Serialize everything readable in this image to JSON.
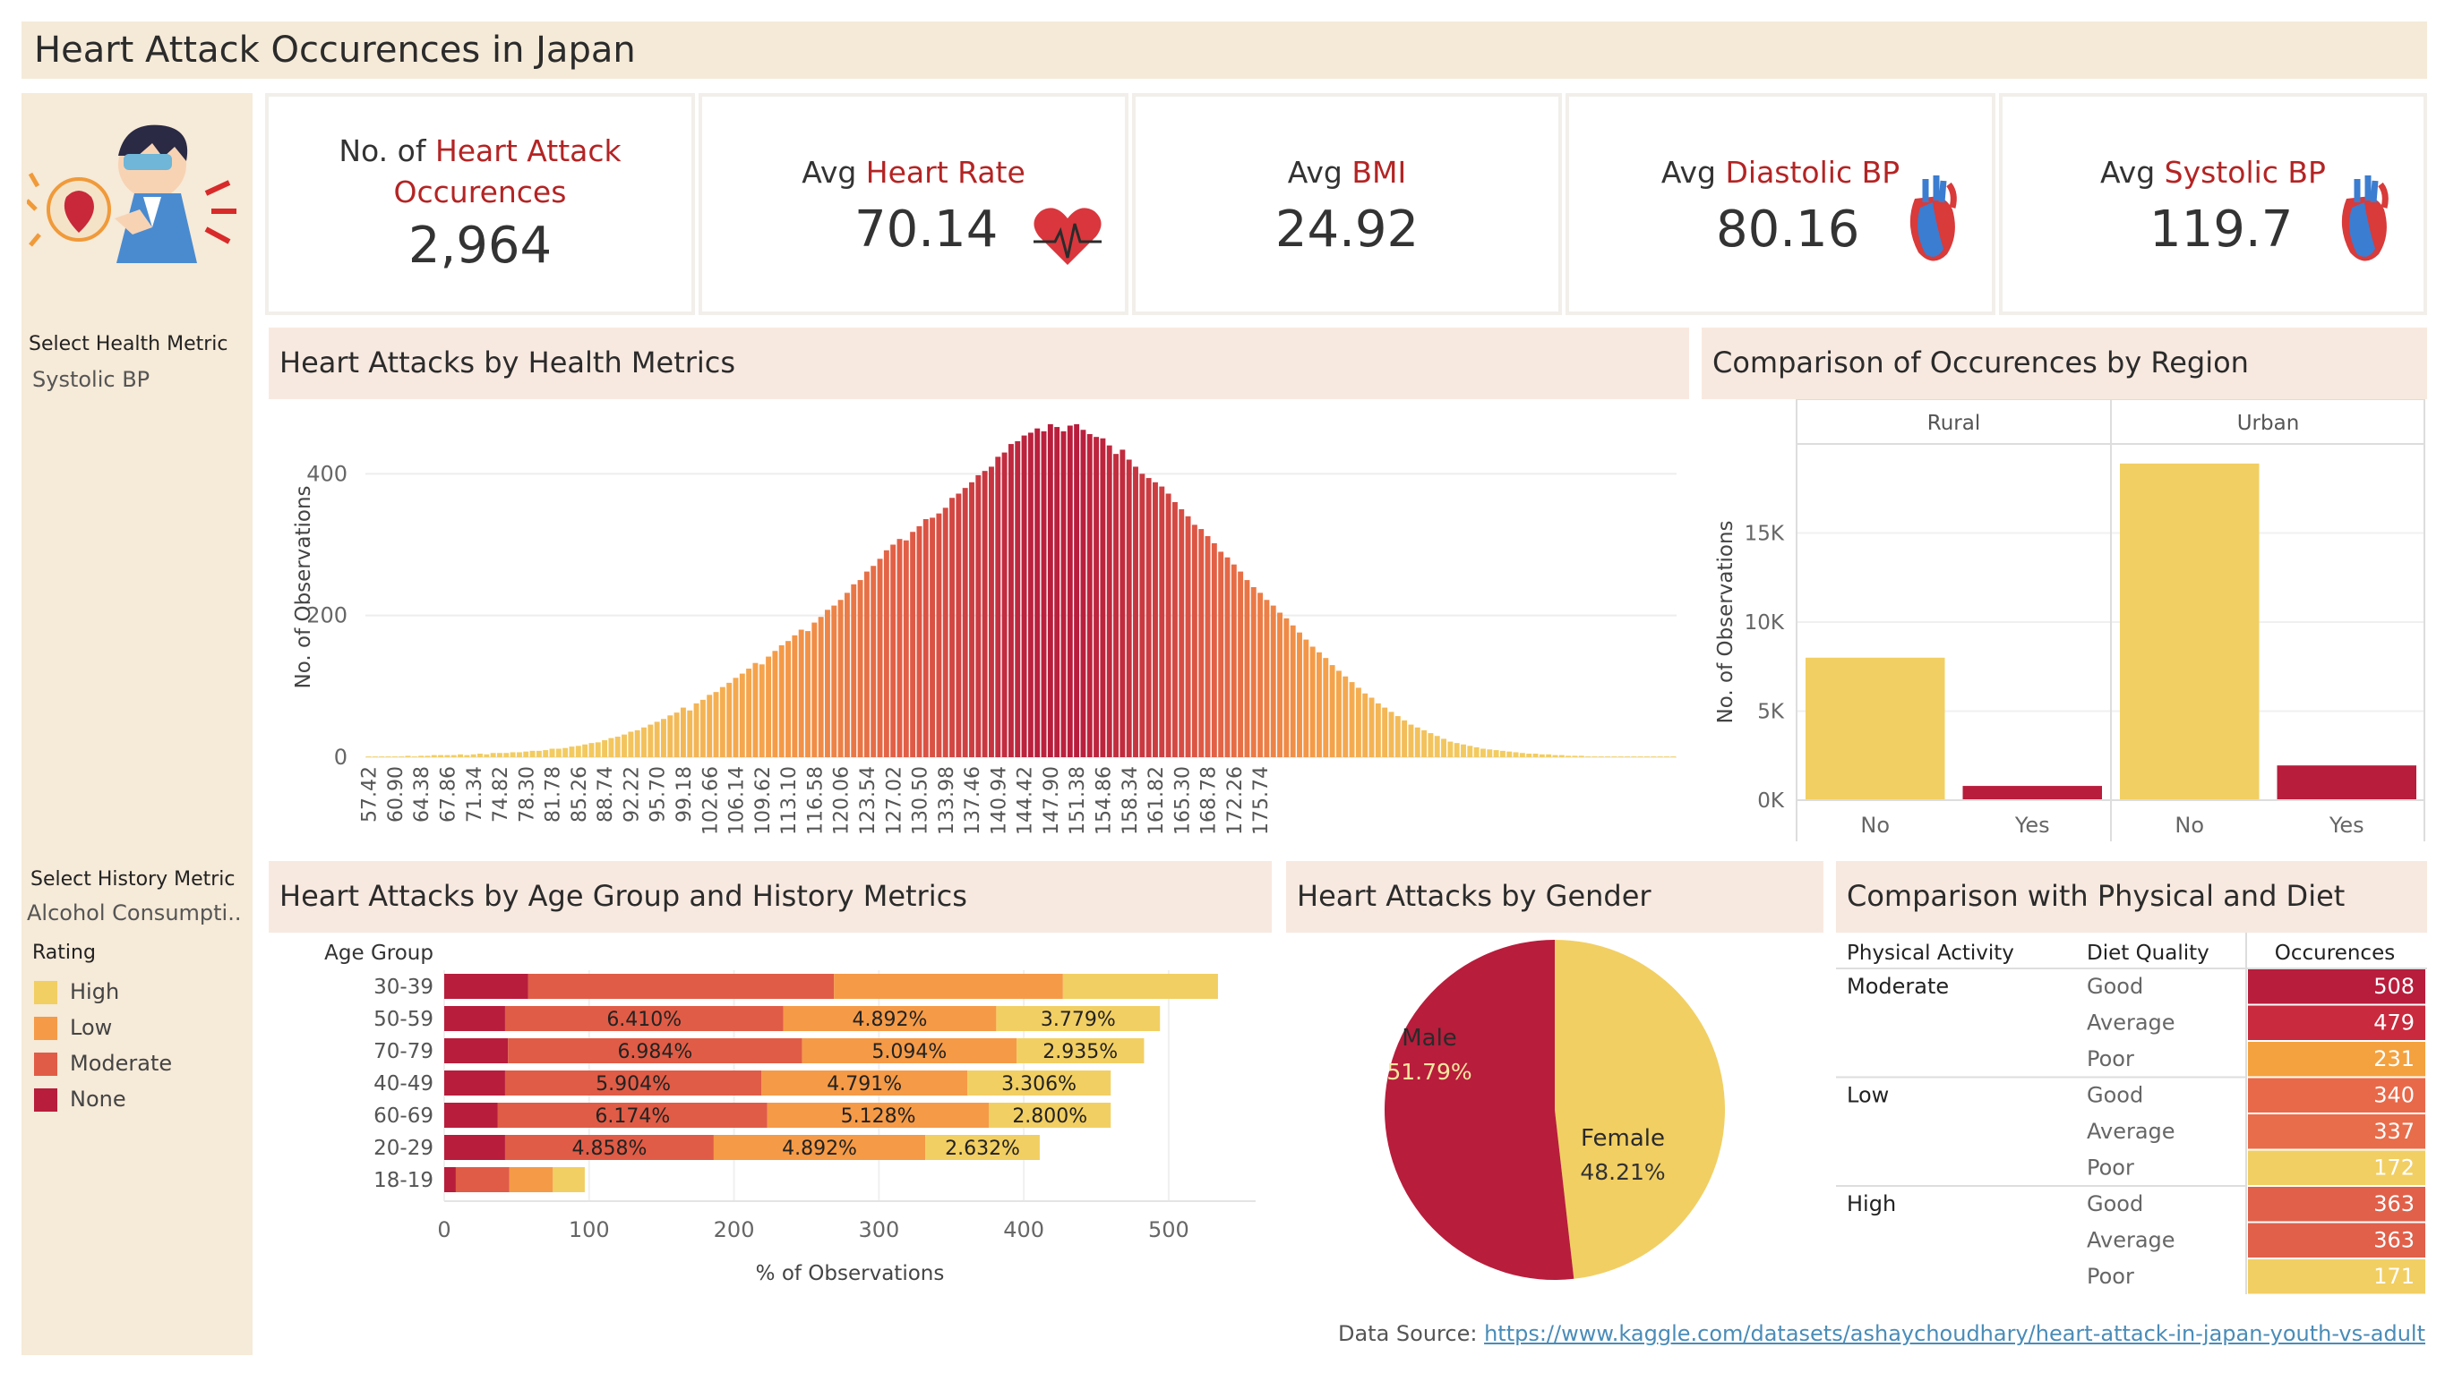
{
  "title": "Heart Attack Occurences in Japan",
  "sidebar": {
    "health_metric_label": "Select Health Metric",
    "health_metric_value": "Systolic BP",
    "history_metric_label": "Select History Metric",
    "history_metric_value": "Alcohol Consumpti..",
    "rating_label": "Rating",
    "rating_items": [
      {
        "label": "High",
        "color": "#f2cf63"
      },
      {
        "label": "Low",
        "color": "#f59a47"
      },
      {
        "label": "Moderate",
        "color": "#e05c46"
      },
      {
        "label": "None",
        "color": "#b81d3c"
      }
    ]
  },
  "kpis": [
    {
      "prefix": "No. of ",
      "highlight": "Heart Attack",
      "line2": "Occurences",
      "value": "2,964",
      "icon": "cartoon-person-chest-pain-icon"
    },
    {
      "prefix": "Avg ",
      "highlight": "Heart Rate",
      "value": "70.14",
      "icon": "heartbeat-icon"
    },
    {
      "prefix": "Avg ",
      "highlight": "BMI",
      "value": "24.92"
    },
    {
      "prefix": "Avg ",
      "highlight": "Diastolic BP",
      "value": "80.16",
      "icon": "anatomical-heart-icon"
    },
    {
      "prefix": "Avg ",
      "highlight": "Systolic BP",
      "value": "119.7",
      "icon": "anatomical-heart-icon"
    }
  ],
  "panels": {
    "health": "Heart Attacks by Health Metrics",
    "region": "Comparison of Occurences by Region",
    "age": "Heart Attacks by Age Group and History Metrics",
    "gender": "Heart Attacks by Gender",
    "physical": "Comparison with Physical and Diet"
  },
  "source": {
    "label": "Data Source:",
    "url": "https://www.kaggle.com/datasets/ashaychoudhary/heart-attack-in-japan-youth-vs-adult"
  },
  "chart_data": [
    {
      "type": "bar",
      "title": "Heart Attacks by Health Metrics",
      "ylabel": "No. of Observations",
      "xlabel": "",
      "ylim": [
        0,
        480
      ],
      "yticks": [
        0,
        200,
        400
      ],
      "x_tick_labels": [
        "57.42",
        "60.90",
        "64.38",
        "67.86",
        "71.34",
        "74.82",
        "78.30",
        "81.78",
        "85.26",
        "88.74",
        "92.22",
        "95.70",
        "99.18",
        "102.66",
        "106.14",
        "109.62",
        "113.10",
        "116.58",
        "120.06",
        "123.54",
        "127.02",
        "130.50",
        "133.98",
        "137.46",
        "140.94",
        "144.42",
        "147.90",
        "151.38",
        "154.86",
        "158.34",
        "161.82",
        "165.30",
        "168.78",
        "172.26",
        "175.74"
      ],
      "x_start": 57.42,
      "bin_width": 0.87,
      "values": [
        1,
        1,
        1,
        1,
        1,
        1,
        2,
        1,
        2,
        2,
        3,
        3,
        3,
        3,
        4,
        3,
        4,
        5,
        4,
        6,
        6,
        6,
        7,
        7,
        8,
        9,
        9,
        10,
        12,
        12,
        13,
        15,
        16,
        18,
        20,
        21,
        24,
        27,
        29,
        32,
        36,
        38,
        42,
        46,
        50,
        54,
        59,
        63,
        70,
        66,
        76,
        81,
        88,
        92,
        99,
        105,
        112,
        118,
        125,
        133,
        131,
        142,
        150,
        158,
        164,
        172,
        180,
        178,
        190,
        198,
        208,
        214,
        222,
        232,
        244,
        250,
        262,
        270,
        280,
        292,
        300,
        308,
        306,
        318,
        326,
        336,
        338,
        344,
        352,
        366,
        372,
        380,
        388,
        398,
        404,
        410,
        424,
        430,
        442,
        446,
        454,
        458,
        464,
        460,
        470,
        466,
        460,
        468,
        470,
        462,
        456,
        452,
        450,
        440,
        428,
        434,
        420,
        410,
        400,
        394,
        388,
        382,
        372,
        360,
        350,
        340,
        328,
        322,
        312,
        302,
        290,
        282,
        272,
        262,
        250,
        240,
        232,
        222,
        214,
        204,
        196,
        186,
        176,
        166,
        156,
        148,
        140,
        130,
        122,
        114,
        106,
        98,
        90,
        84,
        76,
        70,
        64,
        58,
        52,
        46,
        42,
        38,
        34,
        30,
        26,
        22,
        20,
        18,
        16,
        14,
        12,
        11,
        10,
        9,
        8,
        7,
        6,
        5,
        5,
        4,
        4,
        3,
        3,
        2,
        2,
        2,
        1,
        1,
        1,
        1,
        1,
        1,
        1,
        1,
        1,
        1,
        1,
        1,
        1,
        1
      ]
    },
    {
      "type": "bar",
      "title": "Comparison of Occurences by Region",
      "ylabel": "No. of Observations",
      "yticks": [
        "0K",
        "5K",
        "10K",
        "15K"
      ],
      "ylim": [
        0,
        20000
      ],
      "facets": [
        "Rural",
        "Urban"
      ],
      "categories": [
        "No",
        "Yes"
      ],
      "series": [
        {
          "name": "Rural",
          "values": [
            8000,
            800
          ]
        },
        {
          "name": "Urban",
          "values": [
            18900,
            1950
          ]
        }
      ],
      "colors": {
        "No": "#f2cf63",
        "Yes": "#b81d3c"
      }
    },
    {
      "type": "bar",
      "orientation": "horizontal",
      "stacked": true,
      "title": "Heart Attacks by Age Group and History Metrics",
      "ylabel": "Age Group",
      "xlabel": "% of Observations",
      "xlim": [
        0,
        560
      ],
      "xticks": [
        0,
        100,
        200,
        300,
        400,
        500
      ],
      "categories": [
        "30-39",
        "50-59",
        "70-79",
        "40-49",
        "60-69",
        "20-29",
        "18-19"
      ],
      "series": [
        {
          "name": "None",
          "values": [
            58,
            42,
            44,
            42,
            37,
            42,
            8
          ]
        },
        {
          "name": "Moderate",
          "values": [
            211,
            192,
            203,
            177,
            186,
            144,
            37
          ]
        },
        {
          "name": "Low",
          "values": [
            158,
            147,
            148,
            142,
            153,
            146,
            30
          ]
        },
        {
          "name": "High",
          "values": [
            107,
            113,
            88,
            99,
            84,
            79,
            22
          ]
        }
      ],
      "data_labels": {
        "Moderate": [
          "",
          "6.410%",
          "6.984%",
          "5.904%",
          "6.174%",
          "4.858%",
          ""
        ],
        "Low": [
          "",
          "4.892%",
          "5.094%",
          "4.791%",
          "5.128%",
          "4.892%",
          ""
        ],
        "High": [
          "",
          "3.779%",
          "2.935%",
          "3.306%",
          "2.800%",
          "2.632%",
          ""
        ]
      }
    },
    {
      "type": "pie",
      "title": "Heart Attacks by Gender",
      "categories": [
        "Female",
        "Male"
      ],
      "values": [
        48.21,
        51.79
      ],
      "labels": [
        "48.21%",
        "51.79%"
      ],
      "colors": [
        "#f2cf63",
        "#b81d3c"
      ]
    },
    {
      "type": "table",
      "title": "Comparison with Physical and Diet",
      "columns": [
        "Physical Activity",
        "Diet Quality",
        "Occurences"
      ],
      "rows": [
        [
          "Moderate",
          "Good",
          "508"
        ],
        [
          "",
          "Average",
          "479"
        ],
        [
          "",
          "Poor",
          "231"
        ],
        [
          "Low",
          "Good",
          "340"
        ],
        [
          "",
          "Average",
          "337"
        ],
        [
          "",
          "Poor",
          "172"
        ],
        [
          "High",
          "Good",
          "363"
        ],
        [
          "",
          "Average",
          "363"
        ],
        [
          "",
          "Poor",
          "171"
        ]
      ],
      "cell_colors": [
        "#b81d3c",
        "#c92a3d",
        "#f4a23f",
        "#e8694a",
        "#e86d4b",
        "#f2cf63",
        "#e0604a",
        "#e0604a",
        "#f2cf63"
      ]
    }
  ]
}
